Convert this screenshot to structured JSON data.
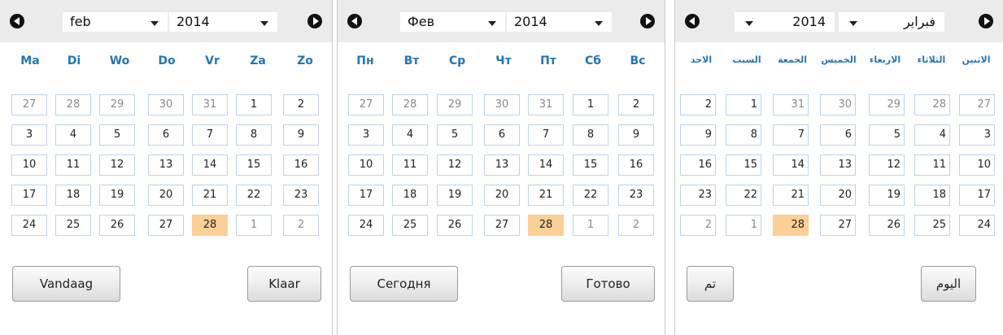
{
  "calendars": [
    {
      "month": "feb",
      "year": "2014",
      "dow": [
        "Ma",
        "Di",
        "Wo",
        "Do",
        "Vr",
        "Za",
        "Zo"
      ],
      "today_button": "Vandaag",
      "done_button": "Klaar"
    },
    {
      "month": "Фев",
      "year": "2014",
      "dow": [
        "Пн",
        "Вт",
        "Ср",
        "Чт",
        "Пт",
        "Сб",
        "Вс"
      ],
      "today_button": "Сегодня",
      "done_button": "Готово"
    },
    {
      "month": "فبراير",
      "year": "2014",
      "dow": [
        "الاثنين",
        "الثلاثاء",
        "الاربعاء",
        "الخميس",
        "الجمعة",
        "السبت",
        "الاحد"
      ],
      "today_button": "اليوم",
      "done_button": "تم"
    }
  ],
  "weeks": [
    [
      "27",
      "28",
      "29",
      "30",
      "31",
      "1",
      "2"
    ],
    [
      "3",
      "4",
      "5",
      "6",
      "7",
      "8",
      "9"
    ],
    [
      "10",
      "11",
      "12",
      "13",
      "14",
      "15",
      "16"
    ],
    [
      "17",
      "18",
      "19",
      "20",
      "21",
      "22",
      "23"
    ],
    [
      "24",
      "25",
      "26",
      "27",
      "28",
      "1",
      "2"
    ]
  ],
  "colors": {
    "header_bg": "#ebebeb",
    "dow_text": "#1d77bd",
    "cell_border": "#bed3e8",
    "today_bg": "#fccf94",
    "other_month_text": "#8a8a8a"
  }
}
